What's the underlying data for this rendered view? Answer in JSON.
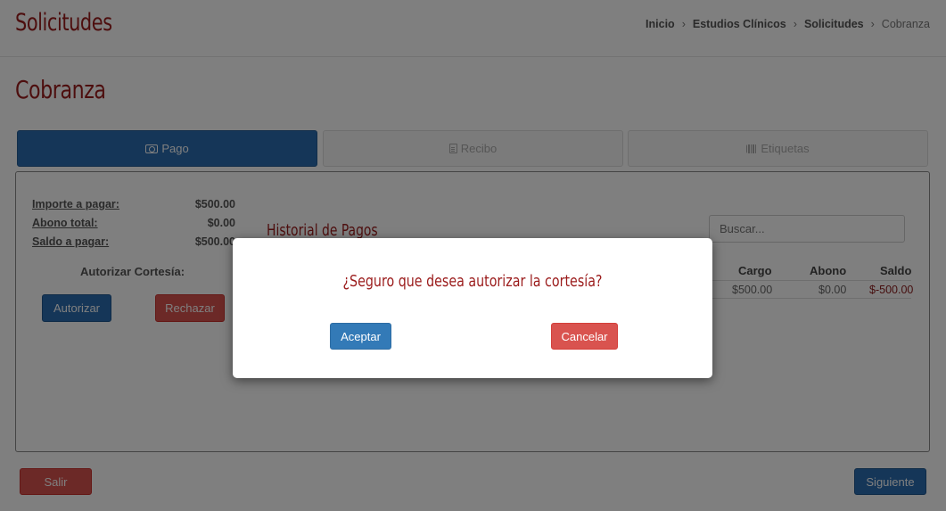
{
  "header": {
    "app_title": "Solicitudes",
    "breadcrumb": [
      {
        "label": "Inicio"
      },
      {
        "label": "Estudios Clínicos"
      },
      {
        "label": "Solicitudes"
      },
      {
        "label": "Cobranza"
      }
    ],
    "separator": "›"
  },
  "page": {
    "title": "Cobranza"
  },
  "tabs": [
    {
      "label": "Pago",
      "icon": "money-icon",
      "active": true
    },
    {
      "label": "Recibo",
      "icon": "file-icon",
      "active": false
    },
    {
      "label": "Etiquetas",
      "icon": "barcode-icon",
      "active": false
    }
  ],
  "summary": {
    "importe_label": "Importe a pagar:",
    "importe_value": "$500.00",
    "abono_label": "Abono total:",
    "abono_value": "$0.00",
    "saldo_label": "Saldo a pagar:",
    "saldo_value": "$500.00",
    "cortesia_label": "Autorizar Cortesía:",
    "autorizar_button": "Autorizar",
    "rechazar_button": "Rechazar"
  },
  "historial": {
    "title": "Historial de Pagos",
    "search_placeholder": "Buscar...",
    "columns": [
      "Cargo",
      "Abono",
      "Saldo"
    ],
    "rows": [
      {
        "cargo": "$500.00",
        "abono": "$0.00",
        "saldo": "$-500.00"
      }
    ]
  },
  "footer": {
    "salir_button": "Salir",
    "siguiente_button": "Siguiente"
  },
  "modal": {
    "question": "¿Seguro que desea autorizar la cortesía?",
    "accept_button": "Aceptar",
    "cancel_button": "Cancelar"
  },
  "colors": {
    "brand_red": "#9b1c1c",
    "primary_blue": "#2b6db0",
    "danger_red": "#d9534f",
    "negative_value": "#8b1a1a"
  }
}
